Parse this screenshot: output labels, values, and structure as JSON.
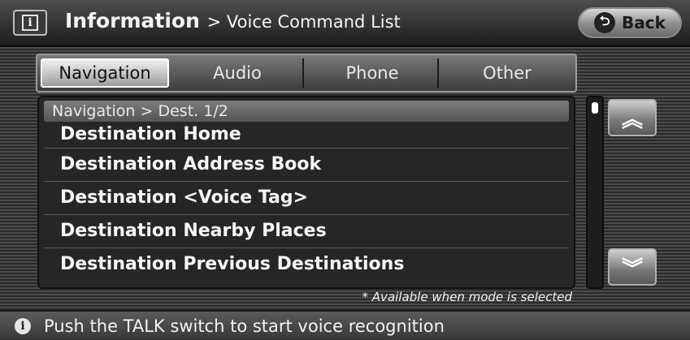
{
  "header": {
    "icon": "info-icon",
    "title": "Information",
    "subtitle": "> Voice Command List",
    "back_label": "Back",
    "back_icon": "back-arrow-icon"
  },
  "tabs": [
    {
      "label": "Navigation",
      "active": true
    },
    {
      "label": "Audio",
      "active": false
    },
    {
      "label": "Phone",
      "active": false
    },
    {
      "label": "Other",
      "active": false
    }
  ],
  "list": {
    "breadcrumb": "Navigation > Dest. 1/2",
    "items": [
      "Destination Home",
      "Destination Address Book",
      "Destination <Voice Tag>",
      "Destination Nearby Places",
      "Destination Previous Destinations"
    ]
  },
  "scroll": {
    "up_icon": "double-chevron-up-icon",
    "down_icon": "double-chevron-down-icon",
    "up_glyph": "︽",
    "down_glyph": "︾"
  },
  "note": "* Available when mode is selected",
  "status": {
    "icon": "info-icon",
    "text": "Push the TALK switch to start voice recognition"
  }
}
